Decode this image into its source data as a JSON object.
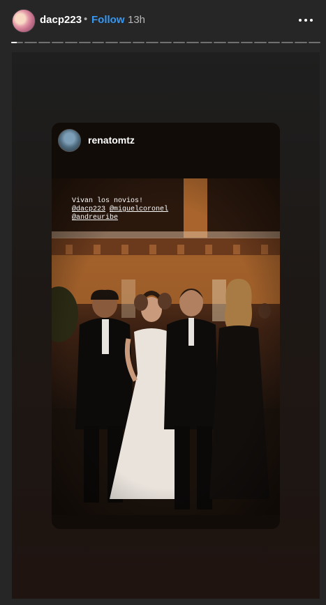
{
  "header": {
    "username": "dacp223",
    "separator": "•",
    "follow_label": "Follow",
    "time": "13h"
  },
  "progress": {
    "segment_count": 23,
    "current_index": 0,
    "current_fraction": 0.45
  },
  "story": {
    "reshared_username": "renatomtz",
    "caption": {
      "line1": "Vivan los novios!",
      "mention1": "@dacp223",
      "mention2": "@miguelcoronel",
      "mention3": "@andreuribe"
    }
  },
  "colors": {
    "background": "#262626",
    "follow": "#3897f0"
  },
  "icons": {
    "more": "more-options-icon"
  }
}
